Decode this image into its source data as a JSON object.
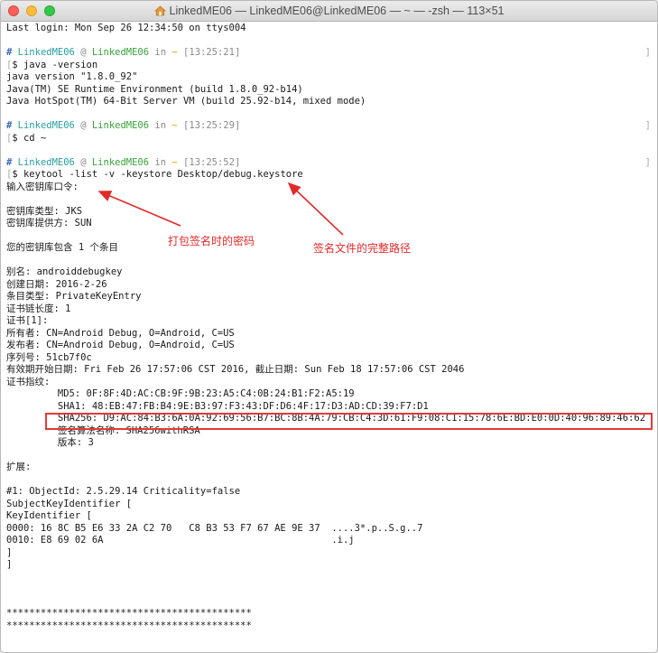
{
  "window": {
    "title": "LinkedME06 — LinkedME06@LinkedME06 — ~ — -zsh — 113×51"
  },
  "terminal": {
    "last_login": "Last login: Mon Sep 26 12:34:50 on ttys004",
    "prompts": [
      {
        "hash": "#",
        "user": "LinkedME06",
        "at": "@",
        "host": "LinkedME06",
        "in": "in",
        "dir": "~",
        "time": "[13:25:21]",
        "command": "java -version"
      },
      {
        "hash": "#",
        "user": "LinkedME06",
        "at": "@",
        "host": "LinkedME06",
        "in": "in",
        "dir": "~",
        "time": "[13:25:29]",
        "command": "cd ~"
      },
      {
        "hash": "#",
        "user": "LinkedME06",
        "at": "@",
        "host": "LinkedME06",
        "in": "in",
        "dir": "~",
        "time": "[13:25:52]",
        "command": "keytool -list -v -keystore Desktop/debug.keystore"
      }
    ],
    "java_output": [
      "java version \"1.8.0_92\"",
      "Java(TM) SE Runtime Environment (build 1.8.0_92-b14)",
      "Java HotSpot(TM) 64-Bit Server VM (build 25.92-b14, mixed mode)"
    ],
    "keytool_output": [
      "输入密钥库口令:",
      "",
      "密钥库类型: JKS",
      "密钥库提供方: SUN",
      "",
      "您的密钥库包含 1 个条目",
      "",
      "别名: androiddebugkey",
      "创建日期: 2016-2-26",
      "条目类型: PrivateKeyEntry",
      "证书链长度: 1",
      "证书[1]:",
      "所有者: CN=Android Debug, O=Android, C=US",
      "发布者: CN=Android Debug, O=Android, C=US",
      "序列号: 51cb7f0c",
      "有效期开始日期: Fri Feb 26 17:57:06 CST 2016, 截止日期: Sun Feb 18 17:57:06 CST 2046",
      "证书指纹:",
      "         MD5: 0F:8F:4D:AC:CB:9F:9B:23:A5:C4:0B:24:B1:F2:A5:19",
      "         SHA1: 48:EB:47:FB:B4:9E:B3:97:F3:43:DF:D6:4F:17:D3:AD:CD:39:F7:D1",
      "         SHA256: D9:AC:84:B3:6A:0A:92:69:56:B7:BC:8B:4A:79:CB:C4:3D:61:F9:08:C1:15:78:6E:BD:E0:0D:40:96:89:46:62",
      "         签名算法名称: SHA256withRSA",
      "         版本: 3",
      "",
      "扩展:",
      "",
      "#1: ObjectId: 2.5.29.14 Criticality=false",
      "SubjectKeyIdentifier [",
      "KeyIdentifier [",
      "0000: 16 8C B5 E6 33 2A C2 70   C8 B3 53 F7 67 AE 9E 37  ....3*.p..S.g..7",
      "0010: E8 69 02 6A                                        .i.j",
      "]",
      "]",
      "",
      "",
      "",
      "*******************************************",
      "*******************************************"
    ]
  },
  "annotations": {
    "password_note": "打包签名时的密码",
    "path_note": "签名文件的完整路径"
  },
  "colors": {
    "annotation": "#e02a2a",
    "host": "#3aa33a",
    "user": "#2a9e9e",
    "dir": "#c9a000"
  }
}
